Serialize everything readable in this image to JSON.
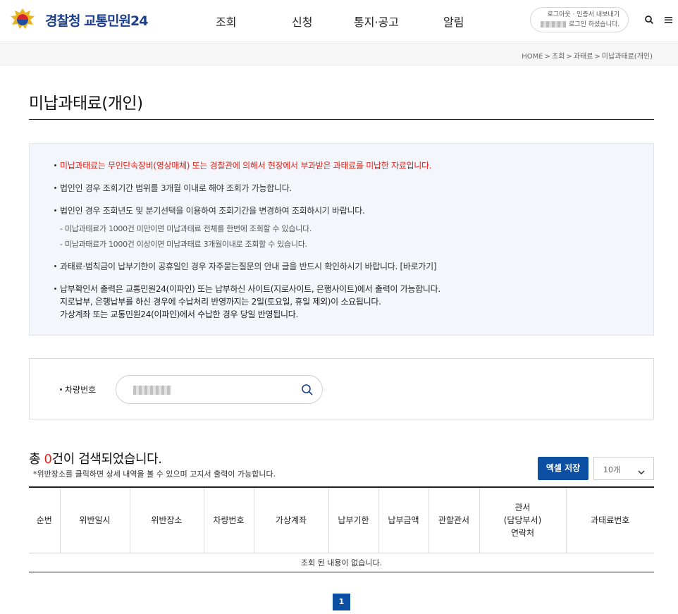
{
  "header": {
    "logo_text": "경찰청 교통민원24",
    "nav": [
      "조회",
      "신청",
      "통지·공고",
      "알림"
    ],
    "login_line1": "로그아웃 · 인증서 내보내기",
    "login_line2": "로그인 하셨습니다.",
    "search_icon": "search-icon",
    "menu_icon": "hamburger-menu-icon"
  },
  "breadcrumb": [
    "HOME",
    "조회",
    "과태료",
    "미납과태료(개인)"
  ],
  "page_title": "미납과태료(개인)",
  "notice": {
    "line1": "미납과태료는 무인단속장비(영상매체) 또는 경찰관에 의해서 현장에서 부과받은 과태료를 미납한 자료입니다.",
    "line2": "법인인 경우 조회기간 범위를 3개월 이내로 해야 조회가 가능합니다.",
    "line3": "법인인 경우 조회년도 및 분기선택을 이용하여 조회기간을 변경하여 조회하시기 바랍니다.",
    "line3_sub1": "- 미납과태료가 1000건 미만이면 미납과태료 전체를 한번에 조회할 수 있습니다.",
    "line3_sub2": "- 미납과태료가 1000건 이상이면 미납과태료 3개월이내로 조회할 수 있습니다.",
    "line4": "과태료·범칙금이 납부기한이 공휴일인 경우 자주묻는질문의 안내 글을 반드시 확인하시기 바랍니다.",
    "line4_link": "[바로가기]",
    "line5a": "납부확인서 출력은 교통민원24(이파인) 또는 납부하신 사이트(지로사이트, 은행사이트)에서 출력이 가능합니다.",
    "line5b": "지로납부, 은행납부를 하신 경우에 수납처리 반영까지는 2일(토요일, 휴일 제외)이 소요됩니다.",
    "line5c": "가상계좌 또는 교통민원24(이파인)에서 수납한 경우 당일 반영됩니다."
  },
  "search": {
    "label": "차량번호"
  },
  "result": {
    "prefix": "총 ",
    "count": "0",
    "suffix": "건이 검색되었습니다.",
    "note": "*위반장소를 클릭하면 상세 내역을 볼 수 있으며 고지서 출력이 가능합니다.",
    "excel_label": "엑셀 저장",
    "page_size": "10개"
  },
  "table": {
    "headers": [
      "순번",
      "위반일시",
      "위반장소",
      "차량번호",
      "가상계좌",
      "납부기한",
      "납부금액",
      "관할관서",
      "관서\n(담당부서)\n연락처",
      "과태료번호"
    ],
    "empty_text": "조회 된 내용이 없습니다."
  },
  "pagination": {
    "current": "1"
  },
  "colors": {
    "brand_blue": "#0b4ea2",
    "logo_blue": "#1b3f8b",
    "alert_red": "#e1251b"
  }
}
